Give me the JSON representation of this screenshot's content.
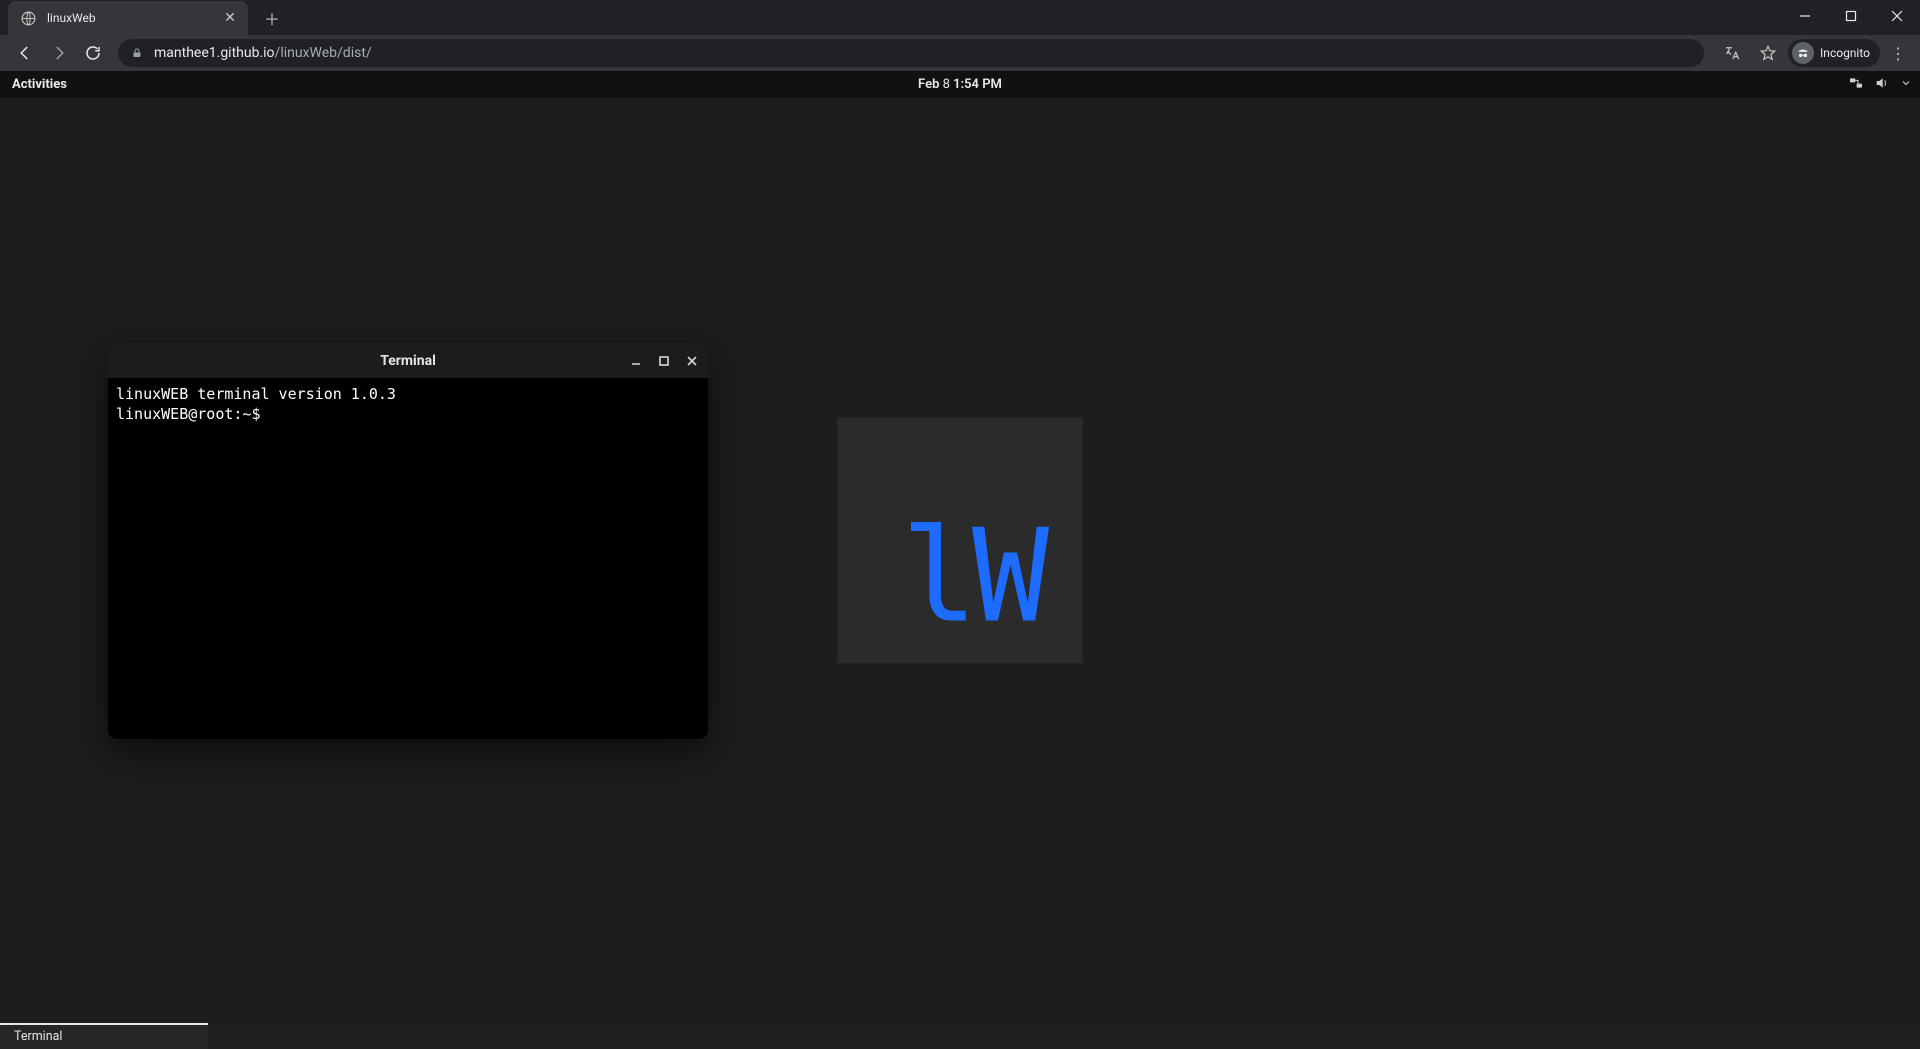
{
  "browser": {
    "tab_title": "linuxWeb",
    "url_host": "manthee1.github.io",
    "url_path": "/linuxWeb/dist/",
    "incognito_label": "Incognito"
  },
  "gnome": {
    "activities_label": "Activities",
    "clock_month": "Feb",
    "clock_day": "8",
    "clock_time": "1:54 PM"
  },
  "desktop": {
    "logo_text": "lW"
  },
  "terminal": {
    "title": "Terminal",
    "line1": "linuxWEB terminal version 1.0.3",
    "prompt": "linuxWEB@root:~$"
  },
  "taskbar": {
    "item0": "Terminal"
  }
}
